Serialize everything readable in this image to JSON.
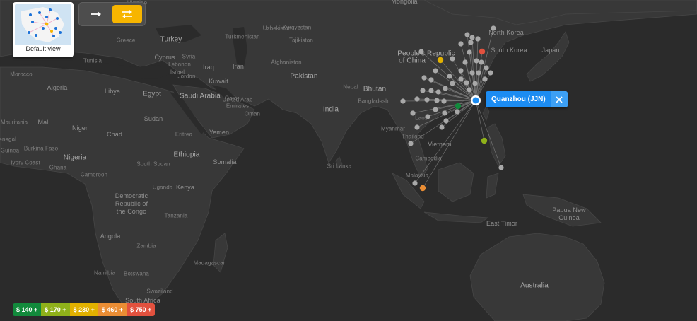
{
  "default_view": {
    "caption": "Default view"
  },
  "direction_toggle": {
    "oneway_icon": "arrow-right-icon",
    "return_icon": "swap-arrows-icon",
    "selected": "return"
  },
  "origin": {
    "label": "Quanzhou (JJN)",
    "close_icon": "close-icon",
    "color": "#1c8cf2"
  },
  "legend": [
    {
      "label": "$ 140 +",
      "color": "#128a3c"
    },
    {
      "label": "$ 170 +",
      "color": "#8fb11a"
    },
    {
      "label": "$ 230 +",
      "color": "#e2b100"
    },
    {
      "label": "$ 460 +",
      "color": "#ea8d34"
    },
    {
      "label": "$ 750 +",
      "color": "#e2513e"
    }
  ],
  "map_labels": [
    "Ukraine",
    "Mongolia",
    "North Korea",
    "South Korea",
    "Japan",
    "Greece",
    "Turkey",
    "Turkmenistan",
    "Kyrgyzstan",
    "Uzbekistan",
    "Tajikistan",
    "Cyprus",
    "Syria",
    "Lebanon",
    "Iraq",
    "Iran",
    "Afghanistan",
    "Israel",
    "Jordan",
    "Kuwait",
    "Pakistan",
    "Nepal",
    "Bhutan",
    "Bangladesh",
    "Myanmar",
    "India",
    "People's Republic of China",
    "Tunisia",
    "Algeria",
    "Libya",
    "Egypt",
    "Saudi Arabia",
    "United Arab Emirates",
    "Qatar",
    "Oman",
    "Yemen",
    "Eritrea",
    "Sudan",
    "Chad",
    "Niger",
    "Mali",
    "Mauritania",
    "Senegal",
    "Burkina Faso",
    "Ivory Coast",
    "Nigeria",
    "Ethiopia",
    "Somalia",
    "South Sudan",
    "Cameroon",
    "Uganda",
    "Kenya",
    "Democratic Republic of the Congo",
    "Tanzania",
    "Angola",
    "Zambia",
    "Namibia",
    "Madagascar",
    "Botswana",
    "South Africa",
    "Swaziland",
    "Thailand",
    "Laos",
    "Vietnam",
    "Cambodia",
    "Sri Lanka",
    "Malaysia",
    "Papua New Guinea",
    "East Timor",
    "Australia",
    "Morocco",
    "Ghana",
    "Guinea"
  ]
}
